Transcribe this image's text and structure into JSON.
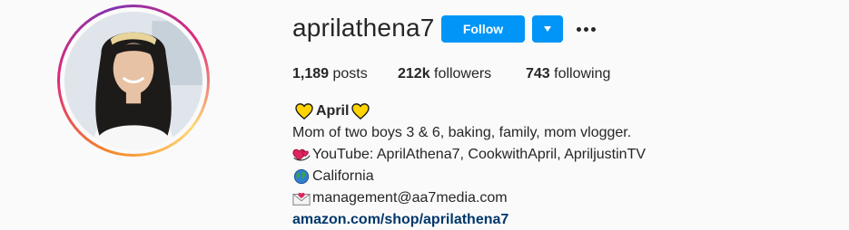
{
  "profile": {
    "username": "aprilathena7",
    "follow_label": "Follow",
    "stats": {
      "posts_count": "1,189",
      "posts_label": " posts",
      "followers_count": "212k",
      "followers_label": " followers",
      "following_count": "743",
      "following_label": " following"
    },
    "bio": {
      "full_name": "April",
      "description": "Mom of two boys 3 & 6, baking, family, mom vlogger.",
      "youtube": "YouTube: AprilAthena7, CookwithApril, ApriljustinTV",
      "location": "California",
      "email": "management@aa7media.com",
      "link": "amazon.com/shop/aprilathena7"
    }
  },
  "icons": {
    "name_prefix": "yellow-heart-icon",
    "name_suffix": "yellow-heart-icon",
    "youtube_line": "revolving-hearts-icon",
    "location_line": "globe-icon",
    "email_line": "love-letter-icon",
    "more_options": "more-horizontal-icon",
    "dropdown": "chevron-down-icon"
  },
  "colors": {
    "primary_button": "#0095f6",
    "link": "#00376b",
    "text": "#262626",
    "background": "#fafafa"
  }
}
